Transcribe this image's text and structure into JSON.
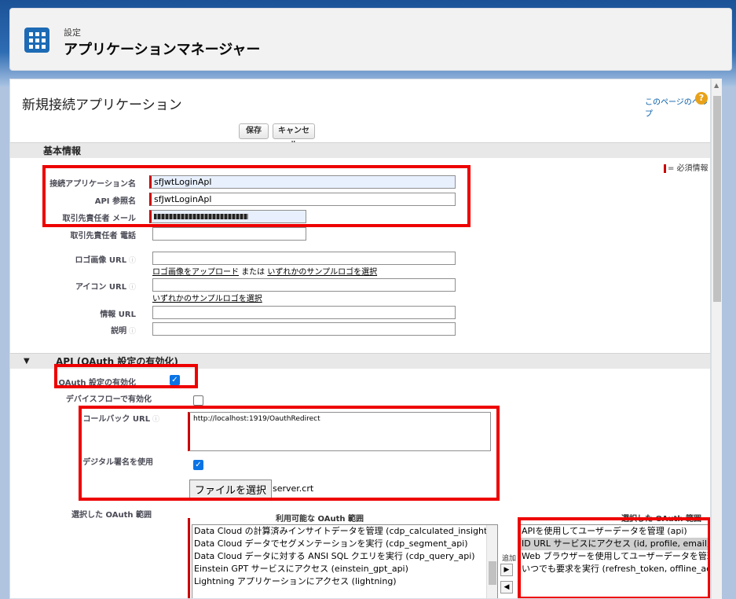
{
  "header": {
    "subtitle": "設定",
    "title": "アプリケーションマネージャー"
  },
  "page": {
    "title": "新規接続アプリケーション",
    "help_link": "このページのヘルプ",
    "help_icon": "?"
  },
  "buttons": {
    "save": "保存",
    "cancel": "キャンセル"
  },
  "basic_section": {
    "title": "基本情報",
    "required_legend": "= 必須情報",
    "fields": {
      "app_name_label": "接続アプリケーション名",
      "app_name_value": "sfJwtLoginApl",
      "api_name_label": "API 参照名",
      "api_name_value": "sfJwtLoginApl",
      "email_label": "取引先責任者 メール",
      "email_value": "",
      "phone_label": "取引先責任者 電話",
      "phone_value": "",
      "logo_label": "ロゴ画像 URL",
      "logo_value": "",
      "logo_link1": "ロゴ画像をアップロード",
      "logo_or": "または",
      "logo_link2": "いずれかのサンプルロゴを選択",
      "icon_label": "アイコン URL",
      "icon_value": "",
      "icon_link": "いずれかのサンプルロゴを選択",
      "info_label": "情報 URL",
      "info_value": "",
      "desc_label": "説明",
      "desc_value": ""
    }
  },
  "api_section": {
    "toggle": "▼",
    "title": "API (OAuth 設定の有効化)",
    "oauth_label": "OAuth 設定の有効化",
    "oauth_checked": true,
    "device_label": "デバイスフローで有効化",
    "device_checked": false,
    "callback_label": "コールバック URL",
    "callback_value": "http://localhost:1919/OauthRedirect",
    "signature_label": "デジタル署名を使用",
    "signature_checked": true,
    "file_button": "ファイルを選択",
    "file_name": "server.crt",
    "scope_label": "選択した OAuth 範囲",
    "available_header": "利用可能な OAuth 範囲",
    "selected_header": "選択した OAuth 範囲",
    "add_label": "追加",
    "available_scopes": [
      "Data Cloud の計算済みインサイトデータを管理 (cdp_calculated_insight_api)",
      "Data Cloud データでセグメンテーションを実行 (cdp_segment_api)",
      "Data Cloud データに対する ANSI SQL クエリを実行 (cdp_query_api)",
      "Einstein GPT サービスにアクセス (einstein_gpt_api)",
      "Lightning アプリケーションにアクセス (lightning)"
    ],
    "selected_scopes": [
      "APIを使用してユーザーデータを管理 (api)",
      "ID URL サービスにアクセス (id, profile, email, address, phone)",
      "Web ブラウザーを使用してユーザーデータを管理 (web)",
      "いつでも要求を実行 (refresh_token, offline_access)"
    ]
  },
  "colors": {
    "required": "#cc0000",
    "highlight_box": "#ee0000",
    "checkbox": "#0b74e5",
    "brand": "#1d6bb5"
  }
}
